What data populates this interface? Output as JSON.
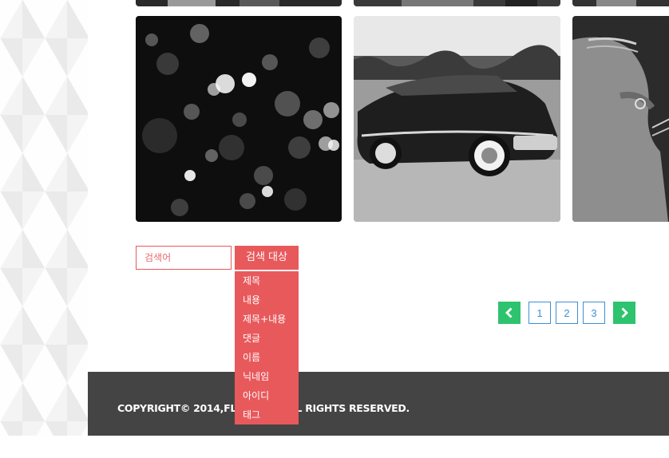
{
  "gallery": {
    "images": [
      {
        "name": "bokeh-lights-photo"
      },
      {
        "name": "vintage-car-photo"
      },
      {
        "name": "hand-guitar-photo"
      }
    ]
  },
  "search": {
    "placeholder": "검색어",
    "target_label": "검색 대상",
    "options": [
      "제목",
      "내용",
      "제목+내용",
      "댓글",
      "이름",
      "닉네임",
      "아이디",
      "태그"
    ]
  },
  "pagination": {
    "prev_icon": "chevron-left-icon",
    "pages": [
      "1",
      "2",
      "3"
    ],
    "next_icon": "chevron-right-icon"
  },
  "footer": {
    "copyright": "COPYRIGHT© 2014,FLATBLOG ALL RIGHTS RESERVED."
  },
  "colors": {
    "accent_red": "#e8595c",
    "accent_green": "#2ec36e",
    "page_blue": "#3d8fd6",
    "footer_bg": "#444444"
  }
}
